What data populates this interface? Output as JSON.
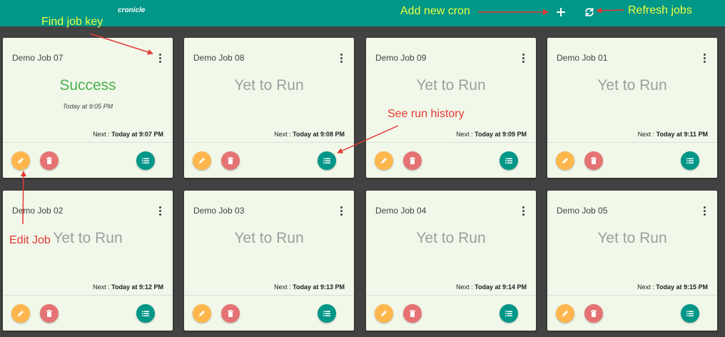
{
  "app": {
    "title": "cronicle"
  },
  "toolbar": {
    "add_icon": "plus-icon",
    "refresh_icon": "sync-icon"
  },
  "jobs": [
    {
      "name": "Demo Job 07",
      "status": "Success",
      "status_kind": "success",
      "last_run": "Today at 9:05 PM",
      "next_label": "Next : ",
      "next_time": "Today at 9:07 PM"
    },
    {
      "name": "Demo Job 08",
      "status": "Yet to Run",
      "status_kind": "pending",
      "last_run": "",
      "next_label": "Next : ",
      "next_time": "Today at 9:08 PM"
    },
    {
      "name": "Demo Job 09",
      "status": "Yet to Run",
      "status_kind": "pending",
      "last_run": "",
      "next_label": "Next : ",
      "next_time": "Today at 9:09 PM"
    },
    {
      "name": "Demo Job 01",
      "status": "Yet to Run",
      "status_kind": "pending",
      "last_run": "",
      "next_label": "Next : ",
      "next_time": "Today at 9:11 PM"
    },
    {
      "name": "Demo Job 02",
      "status": "Yet to Run",
      "status_kind": "pending",
      "last_run": "",
      "next_label": "Next : ",
      "next_time": "Today at 9:12 PM"
    },
    {
      "name": "Demo Job 03",
      "status": "Yet to Run",
      "status_kind": "pending",
      "last_run": "",
      "next_label": "Next : ",
      "next_time": "Today at 9:13 PM"
    },
    {
      "name": "Demo Job 04",
      "status": "Yet to Run",
      "status_kind": "pending",
      "last_run": "",
      "next_label": "Next : ",
      "next_time": "Today at 9:14 PM"
    },
    {
      "name": "Demo Job 05",
      "status": "Yet to Run",
      "status_kind": "pending",
      "last_run": "",
      "next_label": "Next : ",
      "next_time": "Today at 9:15 PM"
    }
  ],
  "annotations": {
    "find_job_key": "Find job key",
    "add_new_cron": "Add new cron",
    "refresh_jobs": "Refresh jobs",
    "see_run_history": "See run history",
    "edit_job": "Edit Job"
  },
  "colors": {
    "appbar": "#009688",
    "background": "#424242",
    "card": "#f1f8e9",
    "success": "#4caf50",
    "pending": "#9e9e9e",
    "edit_button": "#ffb74d",
    "delete_button": "#e57373",
    "history_button": "#009688",
    "annotation_yellow": "#eeff41",
    "annotation_red": "#e53935"
  }
}
